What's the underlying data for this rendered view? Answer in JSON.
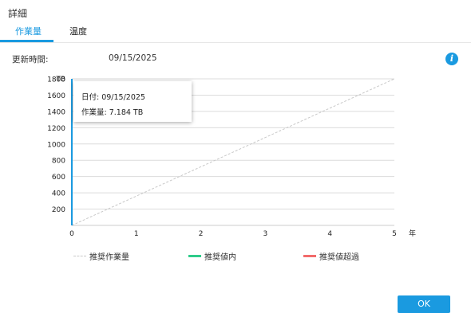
{
  "dialog": {
    "title": "詳細",
    "tabs": [
      {
        "label": "作業量",
        "active": true
      },
      {
        "label": "温度",
        "active": false
      }
    ],
    "updated_label": "更新時間:",
    "updated_value": "09/15/2025",
    "ok_label": "OK",
    "accent_color": "#1a9ae0"
  },
  "tooltip": {
    "line1": "日付: 09/15/2025",
    "line2": "作業量: 7.184 TB"
  },
  "legend": [
    {
      "label": "推奨作業量",
      "color": "#c8c8c8",
      "style": "dashed"
    },
    {
      "label": "推奨値内",
      "color": "#2ecc8a",
      "style": "solid"
    },
    {
      "label": "推奨値超過",
      "color": "#f26b6b",
      "style": "solid"
    }
  ],
  "chart_data": {
    "type": "line",
    "ylabel": "TB",
    "xlabel": "年",
    "xlim": [
      0,
      5
    ],
    "ylim": [
      0,
      1800
    ],
    "xticks": [
      "0",
      "1",
      "2",
      "3",
      "4",
      "5"
    ],
    "yticks": [
      "200",
      "400",
      "600",
      "800",
      "1000",
      "1200",
      "1400",
      "1600",
      "1800"
    ],
    "grid": true,
    "series": [
      {
        "name": "推奨作業量",
        "x": [
          0,
          5
        ],
        "values": [
          0,
          1800
        ]
      }
    ]
  }
}
